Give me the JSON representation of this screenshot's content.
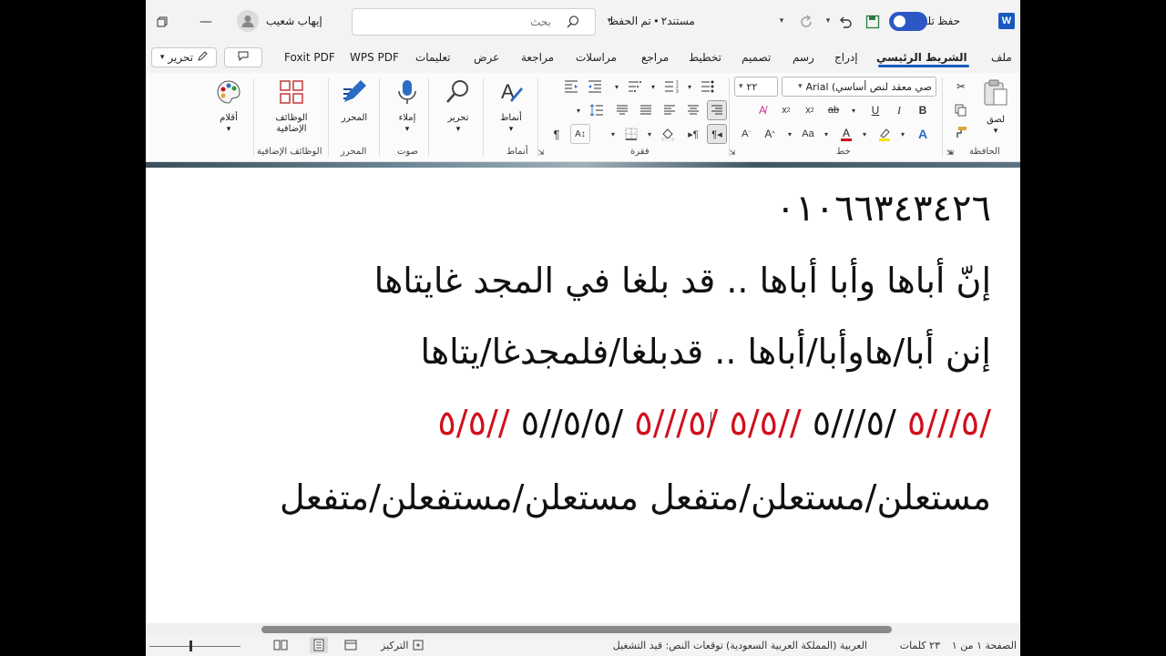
{
  "titlebar": {
    "app_icon": "word-icon",
    "autosave_label": "حفظ تلقائي",
    "doc_title": "مستند٢ • تم الحفظ",
    "search_placeholder": "بحث",
    "user_name": "إيهاب شعيب"
  },
  "tabs": [
    "ملف",
    "الشريط الرئيسي",
    "إدراج",
    "رسم",
    "تصميم",
    "تخطيط",
    "مراجع",
    "مراسلات",
    "مراجعة",
    "عرض",
    "تعليمات",
    "WPS PDF",
    "Foxit PDF"
  ],
  "active_tab": "الشريط الرئيسي",
  "edit_button_label": "تحرير",
  "ribbon": {
    "clipboard": {
      "paste_label": "لصق",
      "group_label": "الحافظة"
    },
    "font": {
      "font_name": "صي معقد لنص أساسي) Arial",
      "font_size": "٢٢",
      "group_label": "خط"
    },
    "paragraph": {
      "group_label": "فقرة"
    },
    "styles": {
      "styles_label": "أنماط",
      "group_label": "أنماط"
    },
    "editing": {
      "label": "تحرير"
    },
    "voice": {
      "dictate_label": "إملاء",
      "group_label": "صوت"
    },
    "editor": {
      "label": "المحرر",
      "group_label": "المحرر"
    },
    "addins": {
      "label": "الوظائف الإضافية",
      "group_label": "الوظائف الإضافية"
    },
    "pens": {
      "label": "أقلام"
    }
  },
  "document": {
    "line_phone": "٠١٠٦٦٣٤٣٤٢٦",
    "line_verse": "إنّ أباها وأبا أباها ..  قد بلغا في المجد غايتاها",
    "line_split": "إنن أبا/هاوأبا/أباها  .. قدبلغا/فلمجدغا/يتاها",
    "scans": [
      {
        "text": "/٥///٥",
        "color": "red"
      },
      {
        "text": " /٥///٥ ",
        "color": "black"
      },
      {
        "text": "//٥/٥  ",
        "color": "red"
      },
      {
        "text": "/٥///٥ ",
        "color": "red"
      },
      {
        "text": " /٥/٥//٥ ",
        "color": "black"
      },
      {
        "text": "//٥/٥",
        "color": "red"
      }
    ],
    "line_feet": "مستعلن/مستعلن/متفعل   مستعلن/مستفعلن/متفعل"
  },
  "statusbar": {
    "page": "الصفحة ١ من ١",
    "words": "٢٣ كلمات",
    "language": "العربية (المملكة العربية السعودية)",
    "predictions": "توقعات النص: قيد التشغيل",
    "focus": "التركيز"
  },
  "colors": {
    "accent": "#185abd",
    "red_text": "#d0101e",
    "toggle": "#2b58c4"
  }
}
